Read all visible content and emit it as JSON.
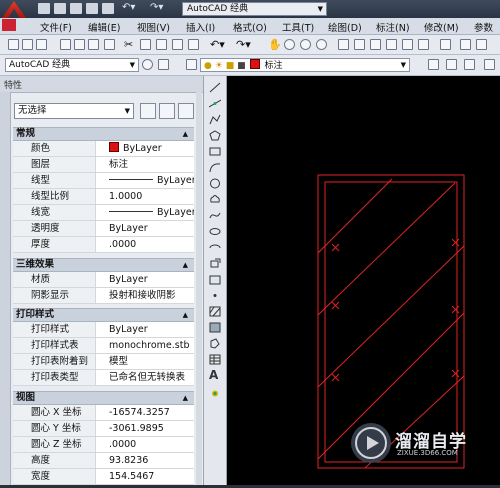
{
  "titlebar": {
    "workspace": "AutoCAD 经典"
  },
  "menu": {
    "items": [
      "文件(F)",
      "编辑(E)",
      "视图(V)",
      "插入(I)",
      "格式(O)",
      "工具(T)",
      "绘图(D)",
      "标注(N)",
      "修改(M)",
      "参数"
    ]
  },
  "toolbar2": {
    "workspace_combo": "AutoCAD 经典",
    "layer_combo": "标注"
  },
  "palette": {
    "selection": "无选择",
    "sections": {
      "general": "常规",
      "threed": "三维效果",
      "plot": "打印样式",
      "view": "视图"
    },
    "rows": {
      "color_k": "颜色",
      "color_v": "ByLayer",
      "layer_k": "图层",
      "layer_v": "标注",
      "linetype_k": "线型",
      "linetype_v": "ByLayer",
      "ltscale_k": "线型比例",
      "ltscale_v": "1.0000",
      "lineweight_k": "线宽",
      "lineweight_v": "ByLayer",
      "transparency_k": "透明度",
      "transparency_v": "ByLayer",
      "thickness_k": "厚度",
      "thickness_v": ".0000",
      "material_k": "材质",
      "material_v": "ByLayer",
      "shadow_k": "阴影显示",
      "shadow_v": "投射和接收阴影",
      "plotstyle_k": "打印样式",
      "plotstyle_v": "ByLayer",
      "plottable_k": "打印样式表",
      "plottable_v": "monochrome.stb",
      "attached_k": "打印表附着到",
      "attached_v": "模型",
      "tabletype_k": "打印表类型",
      "tabletype_v": "已命名但无转换表",
      "cx_k": "圆心 X 坐标",
      "cx_v": "-16574.3257",
      "cy_k": "圆心 Y 坐标",
      "cy_v": "-3061.9895",
      "cz_k": "圆心 Z 坐标",
      "cz_v": ".0000",
      "height_k": "高度",
      "height_v": "93.8236",
      "width_k": "宽度",
      "width_v": "154.5467"
    }
  },
  "watermark": {
    "text": "溜溜自学",
    "url": "ZIXUE.3D66.COM"
  },
  "colors": {
    "accent_red": "#dd2222",
    "canvas": "#000000"
  }
}
